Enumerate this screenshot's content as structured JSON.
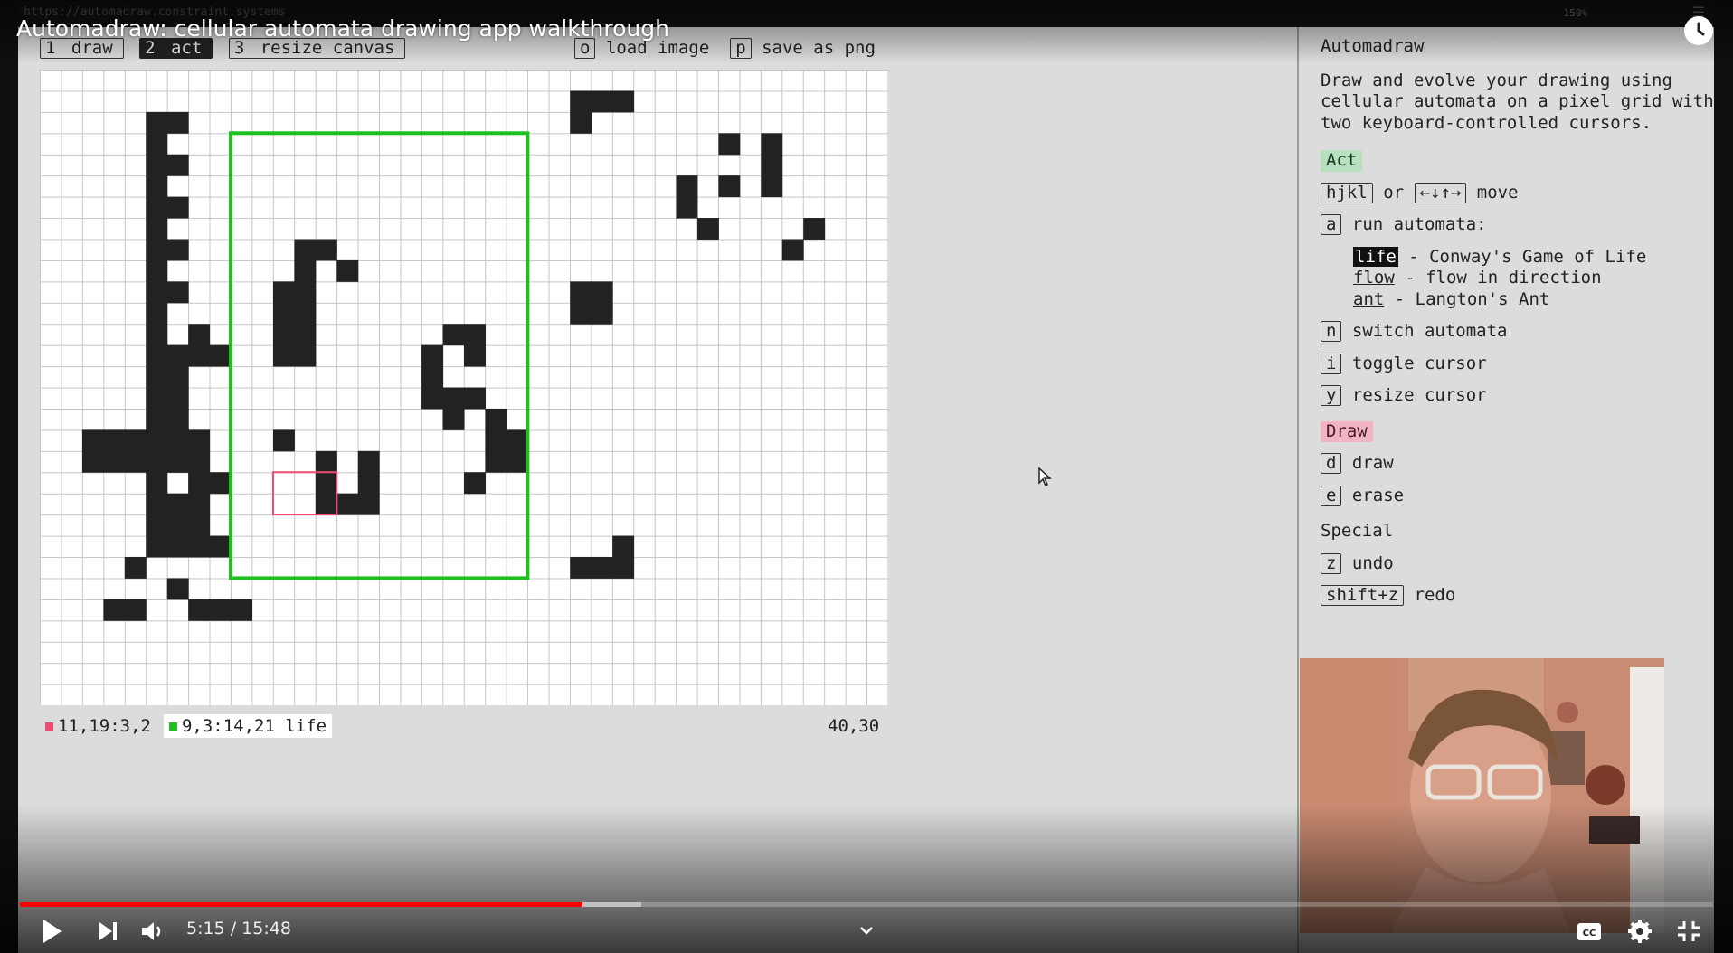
{
  "browser": {
    "url": "https://automadraw.constraint.systems",
    "zoom": "150%"
  },
  "video": {
    "title": "Automadraw: cellular automata drawing app walkthrough",
    "current_time": "5:15",
    "duration": "15:48",
    "time_display": "5:15 / 15:48",
    "progress_fraction": 0.332,
    "buffered_fraction": 0.367
  },
  "app": {
    "mode_tabs": [
      {
        "key": "1",
        "label": "draw",
        "active": false
      },
      {
        "key": "2",
        "label": "act",
        "active": true
      },
      {
        "key": "3",
        "label": "resize canvas",
        "active": false
      }
    ],
    "load": {
      "key": "o",
      "label": "load image"
    },
    "save": {
      "key": "p",
      "label": "save as png"
    },
    "status": {
      "draw_cursor": "11,19:3,2",
      "act_cursor": "9,3:14,21 life",
      "dimensions": "40,30"
    },
    "grid": {
      "cols": 40,
      "rows": 30,
      "filled_cells": [
        [
          5,
          2
        ],
        [
          6,
          2
        ],
        [
          5,
          3
        ],
        [
          5,
          4
        ],
        [
          6,
          4
        ],
        [
          5,
          5
        ],
        [
          5,
          6
        ],
        [
          6,
          6
        ],
        [
          5,
          7
        ],
        [
          5,
          8
        ],
        [
          6,
          8
        ],
        [
          5,
          9
        ],
        [
          5,
          10
        ],
        [
          6,
          10
        ],
        [
          5,
          11
        ],
        [
          5,
          12
        ],
        [
          7,
          12
        ],
        [
          5,
          13
        ],
        [
          6,
          13
        ],
        [
          7,
          13
        ],
        [
          5,
          14
        ],
        [
          6,
          14
        ],
        [
          5,
          15
        ],
        [
          6,
          15
        ],
        [
          5,
          16
        ],
        [
          6,
          16
        ],
        [
          5,
          17
        ],
        [
          6,
          17
        ],
        [
          5,
          18
        ],
        [
          6,
          18
        ],
        [
          5,
          19
        ],
        [
          5,
          20
        ],
        [
          6,
          20
        ],
        [
          5,
          21
        ],
        [
          6,
          21
        ],
        [
          2,
          17
        ],
        [
          3,
          17
        ],
        [
          4,
          17
        ],
        [
          5,
          17
        ],
        [
          6,
          17
        ],
        [
          7,
          17
        ],
        [
          2,
          18
        ],
        [
          3,
          18
        ],
        [
          4,
          18
        ],
        [
          5,
          18
        ],
        [
          6,
          18
        ],
        [
          7,
          18
        ],
        [
          7,
          19
        ],
        [
          7,
          20
        ],
        [
          7,
          21
        ],
        [
          6,
          22
        ],
        [
          7,
          22
        ],
        [
          8,
          22
        ],
        [
          5,
          22
        ],
        [
          4,
          23
        ],
        [
          6,
          24
        ],
        [
          3,
          25
        ],
        [
          4,
          25
        ],
        [
          7,
          25
        ],
        [
          8,
          25
        ],
        [
          9,
          25
        ],
        [
          8,
          13
        ],
        [
          8,
          19
        ],
        [
          12,
          8
        ],
        [
          13,
          8
        ],
        [
          12,
          9
        ],
        [
          14,
          9
        ],
        [
          11,
          10
        ],
        [
          12,
          10
        ],
        [
          11,
          11
        ],
        [
          12,
          11
        ],
        [
          11,
          12
        ],
        [
          12,
          12
        ],
        [
          11,
          13
        ],
        [
          12,
          13
        ],
        [
          11,
          17
        ],
        [
          13,
          18
        ],
        [
          15,
          18
        ],
        [
          13,
          19
        ],
        [
          15,
          19
        ],
        [
          13,
          20
        ],
        [
          14,
          20
        ],
        [
          15,
          20
        ],
        [
          19,
          12
        ],
        [
          20,
          12
        ],
        [
          18,
          13
        ],
        [
          20,
          13
        ],
        [
          18,
          14
        ],
        [
          18,
          15
        ],
        [
          19,
          15
        ],
        [
          20,
          15
        ],
        [
          19,
          16
        ],
        [
          21,
          16
        ],
        [
          21,
          17
        ],
        [
          22,
          17
        ],
        [
          21,
          18
        ],
        [
          22,
          18
        ],
        [
          20,
          19
        ],
        [
          25,
          1
        ],
        [
          26,
          1
        ],
        [
          27,
          1
        ],
        [
          25,
          2
        ],
        [
          32,
          3
        ],
        [
          34,
          3
        ],
        [
          34,
          4
        ],
        [
          30,
          5
        ],
        [
          32,
          5
        ],
        [
          34,
          5
        ],
        [
          30,
          6
        ],
        [
          31,
          7
        ],
        [
          36,
          7
        ],
        [
          35,
          8
        ],
        [
          25,
          10
        ],
        [
          26,
          10
        ],
        [
          25,
          11
        ],
        [
          26,
          11
        ],
        [
          27,
          22
        ],
        [
          25,
          23
        ],
        [
          26,
          23
        ],
        [
          27,
          23
        ]
      ],
      "act_cursor_cells": {
        "col": 9,
        "row": 3,
        "w": 14,
        "h": 21
      },
      "draw_cursor_cells": {
        "col": 11,
        "row": 19,
        "w": 3,
        "h": 2
      }
    },
    "help": {
      "title": "Automadraw",
      "intro": "Draw and evolve your drawing using cellular automata on a pixel grid with two keyboard-controlled cursors.",
      "act_label": "Act",
      "move_keys": "hjkl",
      "move_or": "or",
      "move_arrows": "←↓↑→",
      "move_label": "move",
      "run_key": "a",
      "run_label": "run automata:",
      "automata": [
        {
          "name": "life",
          "desc": "- Conway's Game of Life"
        },
        {
          "name": "flow",
          "desc": "- flow in direction"
        },
        {
          "name": "ant",
          "desc": "- Langton's Ant"
        }
      ],
      "switch": {
        "key": "n",
        "label": "switch automata"
      },
      "toggle": {
        "key": "i",
        "label": "toggle cursor"
      },
      "resize": {
        "key": "y",
        "label": "resize cursor"
      },
      "draw_label": "Draw",
      "draw": {
        "key": "d",
        "label": "draw"
      },
      "erase": {
        "key": "e",
        "label": "erase"
      },
      "special_label": "Special",
      "undo": {
        "key": "z",
        "label": "undo"
      },
      "redo": {
        "key": "shift+z",
        "label": "redo"
      }
    }
  },
  "colors": {
    "act_cursor": "#1ec01e",
    "draw_cursor": "#ee4a72",
    "progress": "#ff0000",
    "tag_act": "#b7e0bf",
    "tag_draw": "#f0b4c3"
  },
  "icons": [
    "clock-icon",
    "play-icon",
    "next-icon",
    "volume-icon",
    "chevron-down-icon",
    "captions-icon",
    "settings-icon",
    "exit-fullscreen-icon",
    "mouse-cursor-icon"
  ]
}
